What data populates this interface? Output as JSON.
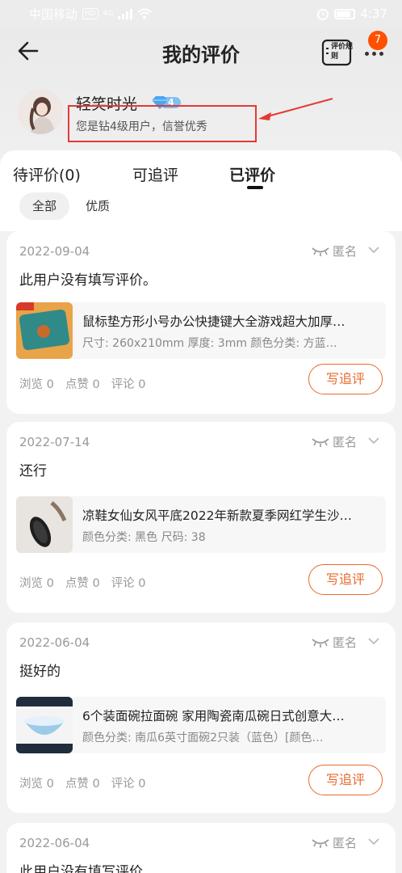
{
  "status_bar": {
    "carrier": "中国移动",
    "hd": "HD",
    "network": "4G",
    "time": "4:37"
  },
  "nav": {
    "title": "我的评价",
    "rules_label": "评价规则",
    "more_badge": "7"
  },
  "user": {
    "name": "轻笑时光",
    "vip_level": "4",
    "description": "您是钻4级用户，信誉优秀"
  },
  "tabs": [
    {
      "label": "待评价(0)"
    },
    {
      "label": "可追评"
    },
    {
      "label": "已评价"
    }
  ],
  "filters": [
    {
      "label": "全部"
    },
    {
      "label": "优质"
    }
  ],
  "reviews": [
    {
      "date": "2022-09-04",
      "anon_label": "匿名",
      "text": "此用户没有填写评价。",
      "product_title": "鼠标垫方形小号办公快捷键大全游戏超大加厚…",
      "product_spec": "尺寸: 260x210mm 厚度: 3mm 颜色分类: 方蓝…",
      "stats": {
        "views": "浏览 0",
        "likes": "点赞 0",
        "comments": "评论 0"
      },
      "action": "写追评"
    },
    {
      "date": "2022-07-14",
      "anon_label": "匿名",
      "text": "还行",
      "product_title": "凉鞋女仙女风平底2022年新款夏季网红学生沙…",
      "product_spec": "颜色分类: 黑色 尺码: 38",
      "stats": {
        "views": "浏览 0",
        "likes": "点赞 0",
        "comments": "评论 0"
      },
      "action": "写追评"
    },
    {
      "date": "2022-06-04",
      "anon_label": "匿名",
      "text": "挺好的",
      "product_title": "6个装面碗拉面碗 家用陶瓷南瓜碗日式创意大…",
      "product_spec": "颜色分类: 南瓜6英寸面碗2只装（蓝色）[颜色…",
      "stats": {
        "views": "浏览 0",
        "likes": "点赞 0",
        "comments": "评论 0"
      },
      "action": "写追评"
    },
    {
      "date": "2022-06-04",
      "anon_label": "匿名",
      "text": "此用户没有填写评价。"
    }
  ],
  "colors": {
    "accent": "#e86a2e",
    "badge": "#ff5000",
    "annotation": "#e53935"
  }
}
